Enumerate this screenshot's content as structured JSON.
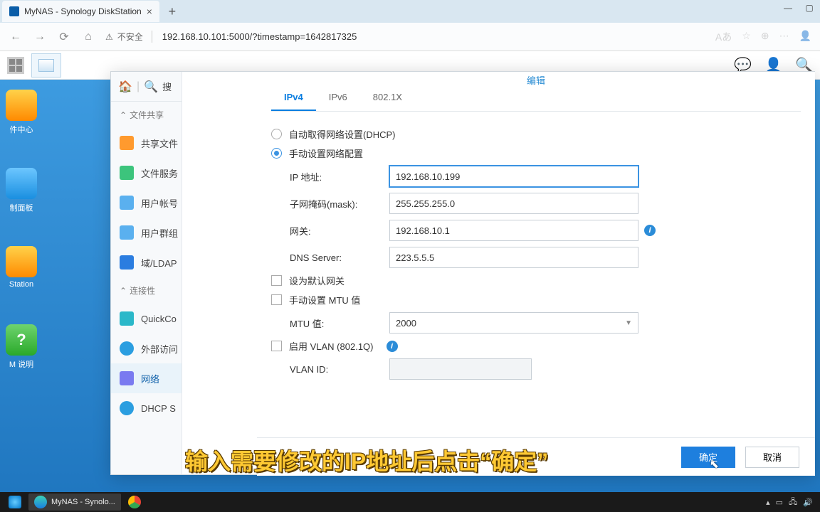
{
  "browser": {
    "tab_title": "MyNAS - Synology DiskStation",
    "security_text": "不安全",
    "url": "192.168.10.101:5000/?timestamp=1642817325"
  },
  "desktop_icons": {
    "i1": "件中心",
    "i2": "制面板",
    "i3": "Station",
    "i4": "M 说明"
  },
  "sidebar": {
    "search": "搜",
    "section_share": "文件共享",
    "items": {
      "shared_folder": "共享文件",
      "file_service": "文件服务",
      "user": "用户帐号",
      "group": "用户群组",
      "ldap": "域/LDAP"
    },
    "section_conn": "连接性",
    "conn_items": {
      "quickconnect": "QuickCo",
      "external": "外部访问",
      "network": "网络",
      "dhcp": "DHCP S"
    }
  },
  "modal": {
    "title": "编辑",
    "tabs": {
      "ipv4": "IPv4",
      "ipv6": "IPv6",
      "dot1x": "802.1X"
    },
    "radio_dhcp": "自动取得网络设置(DHCP)",
    "radio_manual": "手动设置网络配置",
    "labels": {
      "ip": "IP 地址:",
      "mask": "子网掩码(mask):",
      "gateway": "网关:",
      "dns": "DNS Server:",
      "default_gw": "设为默认网关",
      "manual_mtu": "手动设置 MTU 值",
      "mtu": "MTU 值:",
      "vlan": "启用 VLAN (802.1Q)",
      "vlan_id": "VLAN ID:"
    },
    "values": {
      "ip": "192.168.10.199",
      "mask": "255.255.255.0",
      "gateway": "192.168.10.1",
      "dns": "223.5.5.5",
      "mtu": "2000",
      "vlan_id": ""
    },
    "buttons": {
      "ok": "确定",
      "cancel": "取消"
    }
  },
  "subtitle": "输入需要修改的IP地址后点击“确定”",
  "taskbar": {
    "app": "MyNAS - Synolo..."
  }
}
